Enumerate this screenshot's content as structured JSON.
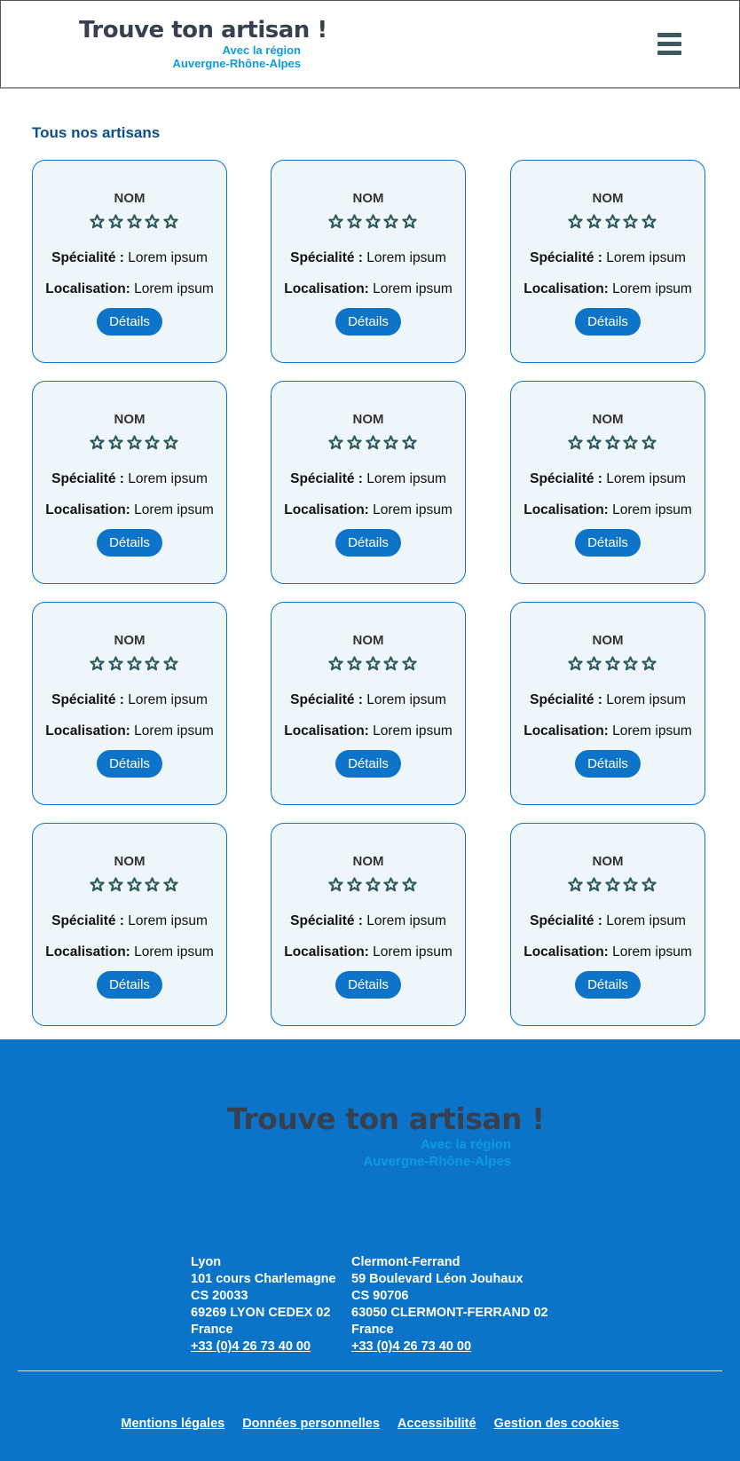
{
  "header": {
    "logo_title": "Trouve ton artisan !",
    "logo_sub1": "Avec la région",
    "logo_sub2": "Auvergne-Rhône-Alpes",
    "menu_icon": "hamburger-menu-icon"
  },
  "main": {
    "section_title": "Tous nos artisans",
    "card": {
      "name": "NOM",
      "rating_stars": 5,
      "star_icon": "star-outline-icon",
      "speciality_label": "Spécialité :",
      "speciality_value": "Lorem ipsum",
      "location_label": "Localisation:",
      "location_value": "Lorem ipsum",
      "details_label": "Détails"
    }
  },
  "footer": {
    "logo_title": "Trouve ton artisan !",
    "logo_sub1": "Avec la région",
    "logo_sub2": "Auvergne-Rhône-Alpes",
    "addresses": [
      {
        "city": "Lyon",
        "street": "101 cours Charlemagne",
        "cs": "CS 20033",
        "postal": "69269 LYON CEDEX 02",
        "country": "France",
        "phone": "+33 (0)4 26 73 40 00"
      },
      {
        "city": "Clermont-Ferrand",
        "street": "59 Boulevard Léon Jouhaux",
        "cs": "CS 90706",
        "postal": "63050 CLERMONT-FERRAND 02",
        "country": "France",
        "phone": "+33 (0)4 26 73 40 00"
      }
    ],
    "links": [
      "Mentions légales",
      "Données personnelles",
      "Accessibilité",
      "Gestion des cookies"
    ]
  },
  "colors": {
    "primary": "#0d74c9",
    "dark_title": "#384050",
    "accent": "#0a9be0",
    "card_bg": "#eef6fa",
    "star": "#2f5a5c"
  }
}
